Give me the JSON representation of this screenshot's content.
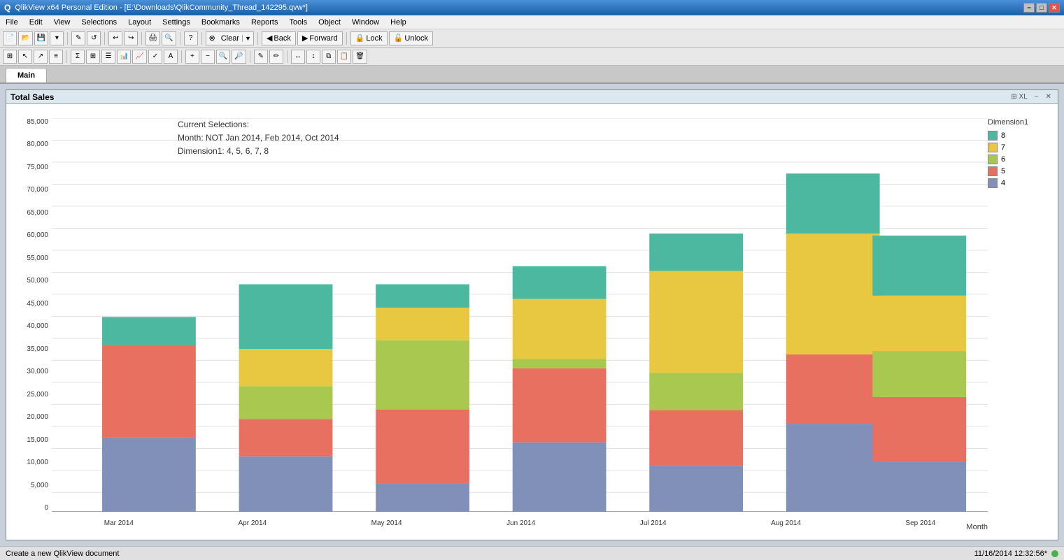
{
  "titlebar": {
    "title": "QlikView x64 Personal Edition - [E:\\Downloads\\QlikCommunity_Thread_142295.qvw*]",
    "icon": "Q",
    "min_label": "−",
    "max_label": "□",
    "close_label": "✕",
    "restore_label": "❐",
    "app_min": "−",
    "app_max": "□",
    "app_close": "✕"
  },
  "menubar": {
    "items": [
      "File",
      "Edit",
      "View",
      "Selections",
      "Layout",
      "Settings",
      "Bookmarks",
      "Reports",
      "Tools",
      "Object",
      "Window",
      "Help"
    ]
  },
  "toolbar1": {
    "clear_label": "Clear",
    "clear_dropdown": "▼",
    "back_label": "Back",
    "forward_label": "Forward",
    "lock_label": "Lock",
    "unlock_label": "Unlock"
  },
  "tab": {
    "name": "Main"
  },
  "chart": {
    "title": "Total Sales",
    "title_controls": [
      "⊞ XL",
      "−",
      "✕"
    ],
    "x_axis_label": "Month",
    "y_axis_values": [
      "85,000",
      "80,000",
      "75,000",
      "70,000",
      "65,000",
      "60,000",
      "55,000",
      "50,000",
      "45,000",
      "40,000",
      "35,000",
      "30,000",
      "25,000",
      "20,000",
      "15,000",
      "10,000",
      "5,000",
      "0"
    ],
    "selections_title": "Current Selections:",
    "selections_month": "Month: NOT Jan 2014, Feb 2014, Oct 2014",
    "selections_dim": "Dimension1: 4, 5, 6, 7, 8",
    "legend_title": "Dimension1",
    "legend_items": [
      {
        "label": "8",
        "color": "#4db8a0"
      },
      {
        "label": "7",
        "color": "#e8c840"
      },
      {
        "label": "6",
        "color": "#a8c850"
      },
      {
        "label": "5",
        "color": "#e87060"
      },
      {
        "label": "4",
        "color": "#8090b8"
      }
    ],
    "bars": [
      {
        "label": "Mar 2014",
        "total": 42000,
        "segments": [
          {
            "dim": "8",
            "value": 6000,
            "color": "#4db8a0"
          },
          {
            "dim": "7",
            "value": 0,
            "color": "#e8c840"
          },
          {
            "dim": "6",
            "value": 0,
            "color": "#a8c850"
          },
          {
            "dim": "5",
            "value": 20000,
            "color": "#e87060"
          },
          {
            "dim": "4",
            "value": 16000,
            "color": "#8090b8"
          }
        ]
      },
      {
        "label": "Apr 2014",
        "total": 49000,
        "segments": [
          {
            "dim": "8",
            "value": 14000,
            "color": "#4db8a0"
          },
          {
            "dim": "7",
            "value": 8000,
            "color": "#e8c840"
          },
          {
            "dim": "6",
            "value": 7000,
            "color": "#a8c850"
          },
          {
            "dim": "5",
            "value": 8000,
            "color": "#e87060"
          },
          {
            "dim": "4",
            "value": 12000,
            "color": "#8090b8"
          }
        ]
      },
      {
        "label": "May 2014",
        "total": 49000,
        "segments": [
          {
            "dim": "8",
            "value": 5000,
            "color": "#4db8a0"
          },
          {
            "dim": "7",
            "value": 7000,
            "color": "#e8c840"
          },
          {
            "dim": "6",
            "value": 15000,
            "color": "#a8c850"
          },
          {
            "dim": "5",
            "value": 16000,
            "color": "#e87060"
          },
          {
            "dim": "4",
            "value": 6000,
            "color": "#8090b8"
          }
        ]
      },
      {
        "label": "Jun 2014",
        "total": 53000,
        "segments": [
          {
            "dim": "8",
            "value": 7000,
            "color": "#4db8a0"
          },
          {
            "dim": "7",
            "value": 13000,
            "color": "#e8c840"
          },
          {
            "dim": "6",
            "value": 2000,
            "color": "#a8c850"
          },
          {
            "dim": "5",
            "value": 16000,
            "color": "#e87060"
          },
          {
            "dim": "4",
            "value": 15000,
            "color": "#8090b8"
          }
        ]
      },
      {
        "label": "Jul 2014",
        "total": 60000,
        "segments": [
          {
            "dim": "8",
            "value": 8000,
            "color": "#4db8a0"
          },
          {
            "dim": "7",
            "value": 22000,
            "color": "#e8c840"
          },
          {
            "dim": "6",
            "value": 8000,
            "color": "#a8c850"
          },
          {
            "dim": "5",
            "value": 12000,
            "color": "#e87060"
          },
          {
            "dim": "4",
            "value": 10000,
            "color": "#8090b8"
          }
        ]
      },
      {
        "label": "Aug 2014",
        "total": 73000,
        "segments": [
          {
            "dim": "8",
            "value": 13000,
            "color": "#4db8a0"
          },
          {
            "dim": "7",
            "value": 26000,
            "color": "#e8c840"
          },
          {
            "dim": "6",
            "value": 0,
            "color": "#a8c850"
          },
          {
            "dim": "5",
            "value": 15000,
            "color": "#e87060"
          },
          {
            "dim": "4",
            "value": 19000,
            "color": "#8090b8"
          }
        ]
      },
      {
        "label": "Sep 2014",
        "total": 60000,
        "segments": [
          {
            "dim": "8",
            "value": 13000,
            "color": "#4db8a0"
          },
          {
            "dim": "7",
            "value": 12000,
            "color": "#e8c840"
          },
          {
            "dim": "6",
            "value": 10000,
            "color": "#a8c850"
          },
          {
            "dim": "5",
            "value": 14000,
            "color": "#e87060"
          },
          {
            "dim": "4",
            "value": 11000,
            "color": "#8090b8"
          }
        ]
      }
    ]
  },
  "statusbar": {
    "message": "Create a new QlikView document",
    "datetime": "11/16/2014 12:32:56*",
    "indicator": "green"
  }
}
